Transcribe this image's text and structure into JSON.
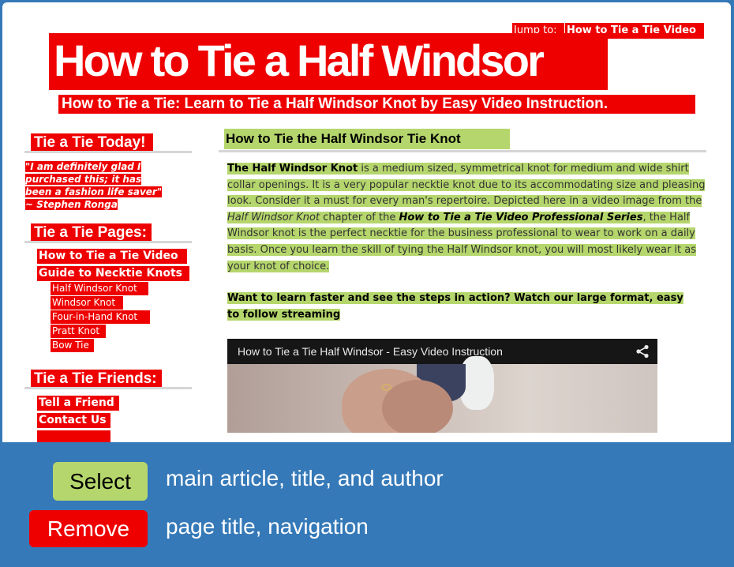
{
  "header": {
    "jump_label": "Jump to:",
    "jump_link": "How to Tie a Tie Video",
    "title": "How to Tie a Half Windsor",
    "subtitle": "How to Tie a Tie: Learn to Tie a Half Windsor Knot by Easy Video Instruction."
  },
  "sidebar": {
    "today_heading": "Tie a Tie Today!",
    "quote_lines": [
      "\"I am definitely glad I",
      "purchased this; it has",
      "been a fashion life saver\"",
      "~ Stephen Ronga"
    ],
    "pages_heading": "Tie a Tie Pages:",
    "pages_links": [
      "How to Tie a Tie Video",
      "Guide to Necktie Knots"
    ],
    "knot_links": [
      "Half Windsor Knot",
      "Windsor Knot",
      "Four-in-Hand Knot",
      "Pratt Knot",
      "Bow Tie"
    ],
    "friends_heading": "Tie a Tie Friends:",
    "friends_links": [
      "Tell a Friend",
      "Contact Us"
    ]
  },
  "main": {
    "heading": "How to Tie the Half Windsor Tie Knot",
    "p1_bold_intro": "The Half Windsor Knot",
    "p1_text1": " is a medium sized, symmetrical knot for medium and wide shirt collar openings. It is a very popular necktie knot due to its accommodating size and pleasing look.  Consider it a must for every man's repertoire. Depicted here in a video image from the ",
    "p1_italic": "Half Windsor Knot",
    "p1_text2": " chapter of the ",
    "p1_bold_italic": "How to Tie a Tie Video Professional Series",
    "p1_text3": ", the Half Windsor knot is the perfect necktie for the business professional to wear to work on a daily basis. Once you learn the skill of tying the Half Windsor knot, you will most likely wear it as your knot of choice.",
    "cta": "Want to learn faster and see the steps in action? Watch our large format, easy to follow streaming",
    "video_title": "How to Tie a Tie Half Windsor - Easy Video Instruction"
  },
  "legend": {
    "select_label": "Select",
    "select_desc": "main article, title, and author",
    "remove_label": "Remove",
    "remove_desc": "page title, navigation",
    "select_color": "#b5d66c",
    "remove_color": "#ee0000",
    "background_color": "#3579b8"
  }
}
